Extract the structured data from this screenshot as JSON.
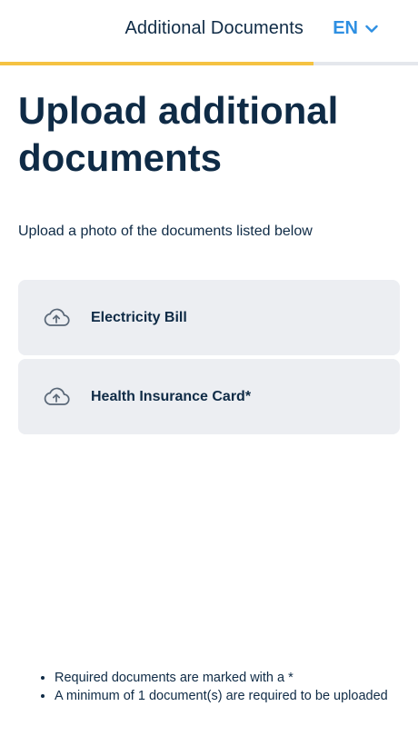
{
  "header": {
    "title": "Additional Documents",
    "language": "EN",
    "language_icon": "chevron-down-icon",
    "accent_color": "#2e8fe2"
  },
  "progress": {
    "fraction": 0.75,
    "fill_color": "#f5c242"
  },
  "main": {
    "title": "Upload additional documents",
    "subtitle": "Upload a photo of the documents listed below"
  },
  "documents": [
    {
      "label": "Electricity Bill",
      "icon": "cloud-upload-icon"
    },
    {
      "label": "Health Insurance Card*",
      "icon": "cloud-upload-icon"
    }
  ],
  "notes": [
    "Required documents are marked with a *",
    "A minimum of 1 document(s) are required to be uploaded"
  ]
}
